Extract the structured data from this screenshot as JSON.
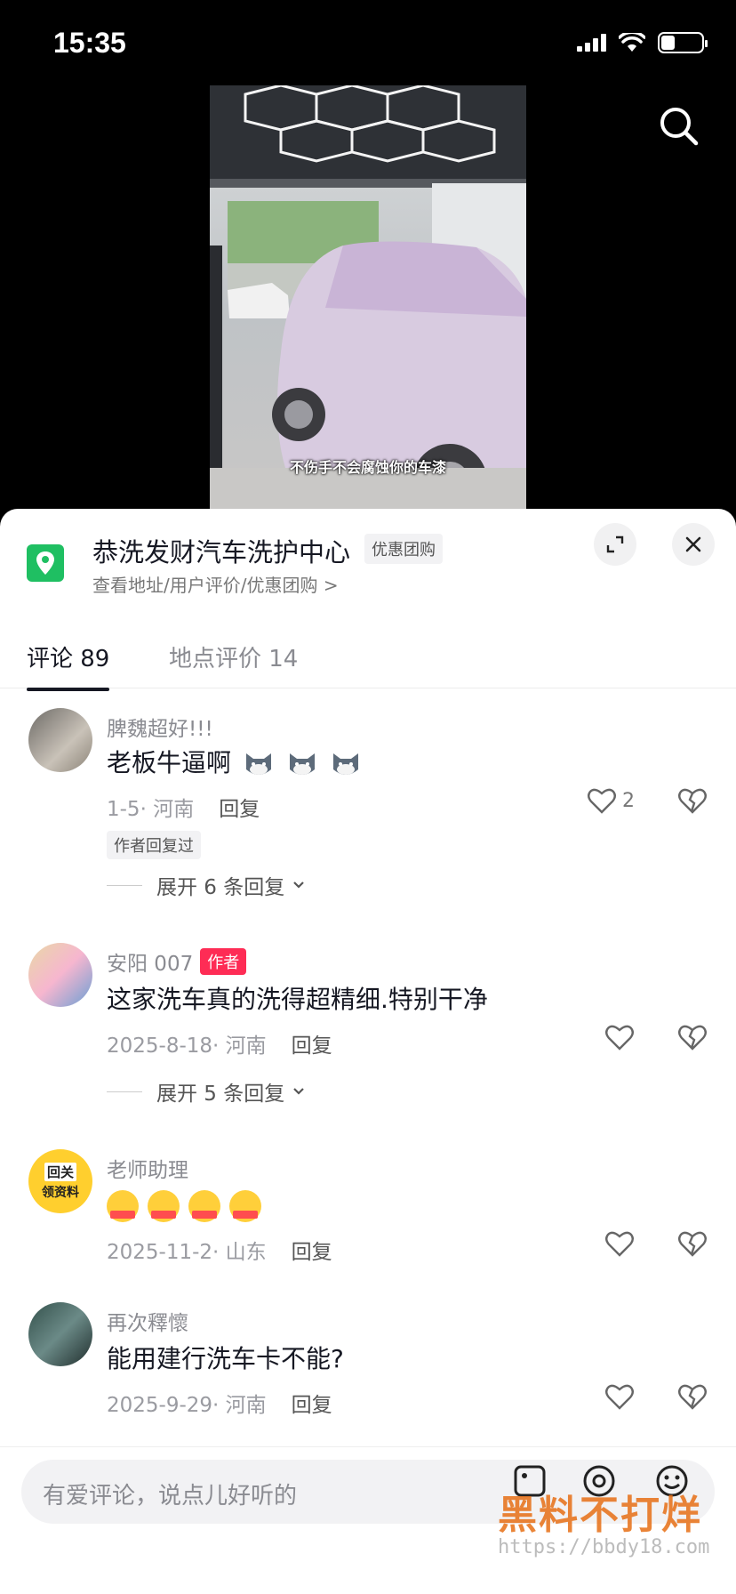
{
  "status": {
    "time": "15:35",
    "battery_level": 0.35
  },
  "video": {
    "caption": "不伤手不会腐蚀你的车漆"
  },
  "poi": {
    "title": "恭洗发财汽车洗护中心",
    "tag": "优惠团购",
    "subtitle": "查看地址/用户评价/优惠团购 >"
  },
  "tabs": [
    {
      "label": "评论 89",
      "active": true
    },
    {
      "label": "地点评价 14",
      "active": false
    }
  ],
  "comments": [
    {
      "user": "脾魏超好!!!",
      "text": "老板牛逼啊",
      "emoji_count": 3,
      "date_location": "1-5· 河南",
      "reply_label": "回复",
      "likes": "2",
      "tag": "作者回复过",
      "expand": "展开 6 条回复"
    },
    {
      "user": "安阳 007",
      "badge": "作者",
      "text": "这家洗车真的洗得超精细.特别干净",
      "date_location": "2025-8-18· 河南",
      "reply_label": "回复",
      "expand": "展开 5 条回复"
    },
    {
      "user": "老师助理",
      "avatar_text_1": "回关",
      "avatar_text_2": "领资料",
      "emoji_label": "关注我",
      "date_location": "2025-11-2· 山东",
      "reply_label": "回复"
    },
    {
      "user": "再次釋懷",
      "text": "能用建行洗车卡不能?",
      "date_location": "2025-9-29· 河南",
      "reply_label": "回复"
    }
  ],
  "input": {
    "placeholder": "有爱评论，说点儿好听的"
  },
  "watermark": {
    "text": "黑料不打烊",
    "url": "https://bbdy18.com"
  },
  "colors": {
    "accent": "#fe2c55",
    "poi_green": "#1fbf62"
  }
}
